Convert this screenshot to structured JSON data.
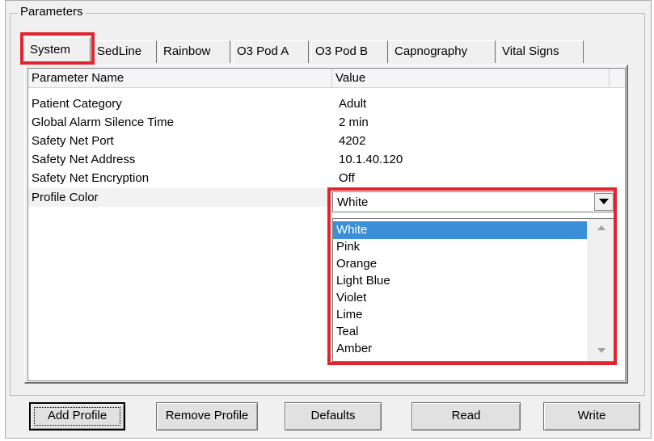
{
  "group": {
    "title": "Parameters"
  },
  "tabs": [
    {
      "label": "System"
    },
    {
      "label": "SedLine"
    },
    {
      "label": "Rainbow"
    },
    {
      "label": "O3 Pod A"
    },
    {
      "label": "O3 Pod B"
    },
    {
      "label": "Capnography"
    },
    {
      "label": "Vital Signs"
    }
  ],
  "table": {
    "columns": [
      "Parameter Name",
      "Value"
    ],
    "rows": [
      {
        "name": "Patient Category",
        "value": "Adult"
      },
      {
        "name": "Global Alarm Silence Time",
        "value": "2 min"
      },
      {
        "name": "Safety Net Port",
        "value": "4202"
      },
      {
        "name": "Safety Net Address",
        "value": "10.1.40.120"
      },
      {
        "name": "Safety Net Encryption",
        "value": "Off"
      },
      {
        "name": "Profile Color",
        "value": ""
      }
    ]
  },
  "combo": {
    "selected": "White",
    "options": [
      "White",
      "Pink",
      "Orange",
      "Light Blue",
      "Violet",
      "Lime",
      "Teal",
      "Amber"
    ]
  },
  "buttons": {
    "add": "Add Profile",
    "remove": "Remove Profile",
    "defaults": "Defaults",
    "read": "Read",
    "write": "Write"
  },
  "colors": {
    "highlight": "#e0252f",
    "selection": "#3a8fd6"
  }
}
